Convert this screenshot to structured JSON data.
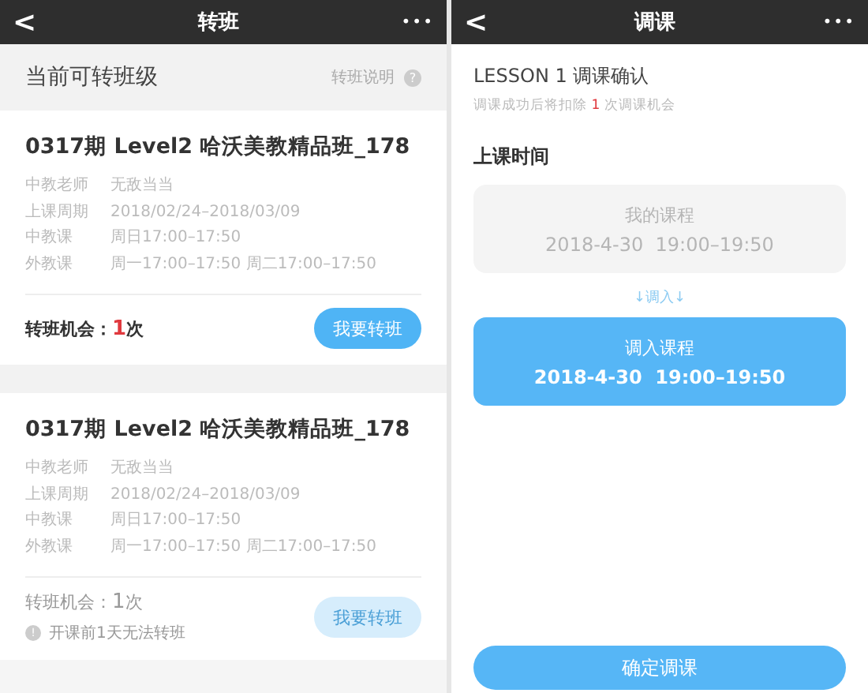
{
  "left": {
    "header": {
      "back": "<",
      "title": "转班",
      "more": "•••"
    },
    "section": {
      "title": "当前可转班级",
      "help_link": "转班说明",
      "help_icon": "?"
    },
    "cards": [
      {
        "title": "0317期 Level2 哈沃美教精品班_178",
        "rows": [
          {
            "label": "中教老师",
            "value": "无敌当当"
          },
          {
            "label": "上课周期",
            "value": "2018/02/24–2018/03/09"
          },
          {
            "label": "中教课",
            "value": "周日17:00–17:50"
          },
          {
            "label": "外教课",
            "value": "周一17:00–17:50 周二17:00–17:50"
          }
        ],
        "chances_label": "转班机会：",
        "chances_count": "1",
        "chances_unit": "次",
        "button": "我要转班",
        "disabled": false
      },
      {
        "title": "0317期 Level2 哈沃美教精品班_178",
        "rows": [
          {
            "label": "中教老师",
            "value": "无敌当当"
          },
          {
            "label": "上课周期",
            "value": "2018/02/24–2018/03/09"
          },
          {
            "label": "中教课",
            "value": "周日17:00–17:50"
          },
          {
            "label": "外教课",
            "value": "周一17:00–17:50 周二17:00–17:50"
          }
        ],
        "chances_label": "转班机会：",
        "chances_count": "1",
        "chances_unit": "次",
        "button": "我要转班",
        "disabled": true,
        "note_icon": "!",
        "note": "开课前1天无法转班"
      }
    ]
  },
  "right": {
    "header": {
      "back": "<",
      "title": "调课",
      "more": "•••"
    },
    "heading": "LESSON 1 调课确认",
    "subtitle": "调课成功后将扣除 **1** 次调课机会",
    "time_label": "上课时间",
    "my_course": {
      "title": "我的课程",
      "time": "2018-4-30  19:00–19:50"
    },
    "arrow_label": "↓调入↓",
    "new_course": {
      "title": "调入课程",
      "time": "2018-4-30  19:00–19:50"
    },
    "confirm_button": "确定调课"
  }
}
